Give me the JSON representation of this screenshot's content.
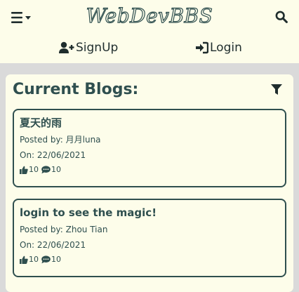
{
  "header": {
    "brand": "WebDevBBS",
    "menu_icon": "hamburger-menu-icon",
    "menu_caret_icon": "caret-down-icon",
    "search_icon": "search-icon"
  },
  "nav": {
    "signup_label": "SignUp",
    "signup_icon": "user-plus-icon",
    "login_label": "Login",
    "login_icon": "sign-in-icon"
  },
  "blogs": {
    "heading": "Current Blogs:",
    "filter_icon": "filter-icon",
    "items": [
      {
        "title": "夏天的雨",
        "author_line": "Posted by: 月月luna",
        "date_line": "On: 22/06/2021",
        "likes": "10",
        "comments": "10"
      },
      {
        "title": "login to see the magic!",
        "author_line": "Posted by: Zhou Tian",
        "date_line": "On: 22/06/2021",
        "likes": "10",
        "comments": "10"
      }
    ]
  },
  "colors": {
    "primary": "#2f4f4f",
    "background": "#fdfdea",
    "page_background": "#dadada"
  }
}
